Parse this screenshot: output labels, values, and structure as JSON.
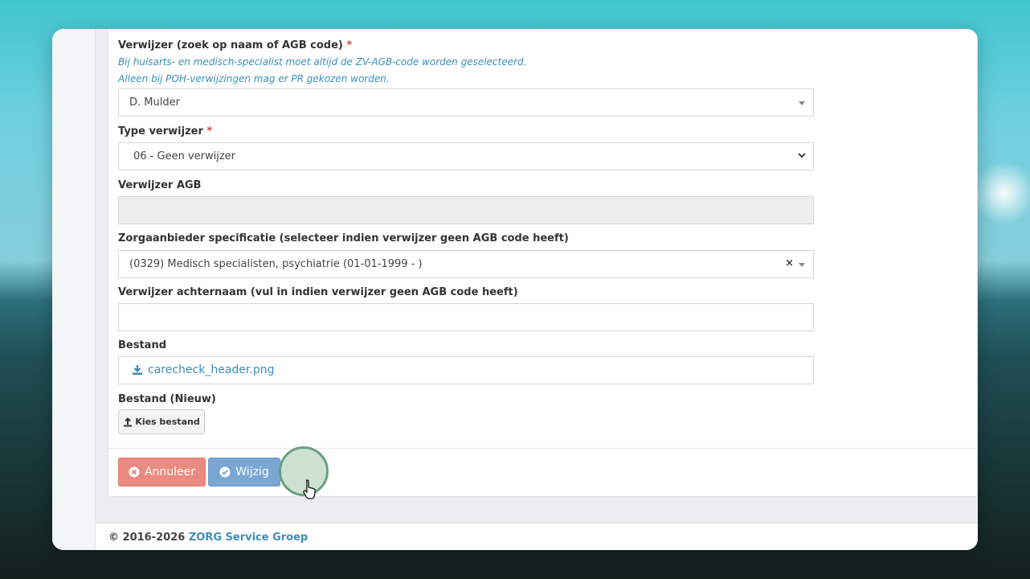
{
  "form": {
    "verwijzer": {
      "label": "Verwijzer (zoek op naam of AGB code)",
      "required": "*",
      "hint_1": "Bij huisarts- en medisch-specialist moet altijd de ZV-AGB-code worden geselecteerd.",
      "hint_2": "Alleen bij POH-verwijzingen mag er PR gekozen worden.",
      "value": "D. Mulder"
    },
    "type_verwijzer": {
      "label": "Type verwijzer",
      "required": "*",
      "value": "06 - Geen verwijzer"
    },
    "verwijzer_agb": {
      "label": "Verwijzer AGB",
      "value": ""
    },
    "zorgaanbieder": {
      "label": "Zorgaanbieder specificatie (selecteer indien verwijzer geen AGB code heeft)",
      "value": "(0329) Medisch specialisten, psychiatrie (01-01-1999 - )",
      "clear": "×"
    },
    "achternaam": {
      "label": "Verwijzer achternaam (vul in indien verwijzer geen AGB code heeft)",
      "value": ""
    },
    "bestand": {
      "label": "Bestand",
      "file_name": "carecheck_header.png"
    },
    "bestand_nieuw": {
      "label": "Bestand (Nieuw)",
      "button_label": "Kies bestand"
    }
  },
  "actions": {
    "cancel_label": "Annuleer",
    "submit_label": "Wijzig"
  },
  "footer": {
    "copyright": "© 2016-2026",
    "company": "ZORG Service Groep"
  },
  "colors": {
    "accent": "#3c8dbc",
    "danger": "#ea8b82",
    "primary": "#7aa7d2",
    "required": "#dd4b39"
  }
}
